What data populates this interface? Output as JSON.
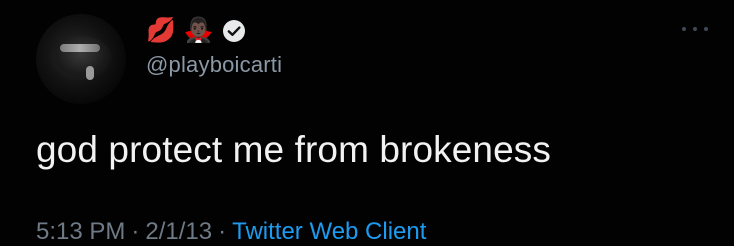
{
  "tweet": {
    "author": {
      "name_emojis": [
        "💋",
        "🧛🏿‍♂️"
      ],
      "handle": "@playboicarti",
      "avatar_icon": "profile-avatar"
    },
    "text": "god protect me from brokeness",
    "time": "5:13 PM",
    "date": "2/1/13",
    "separator": "·",
    "client": "Twitter Web Client",
    "more_icon": "more-options-icon"
  },
  "colors": {
    "background": "#020202",
    "text": "#f2f2f2",
    "muted": "#6e7a85",
    "link": "#1d9bf0"
  }
}
